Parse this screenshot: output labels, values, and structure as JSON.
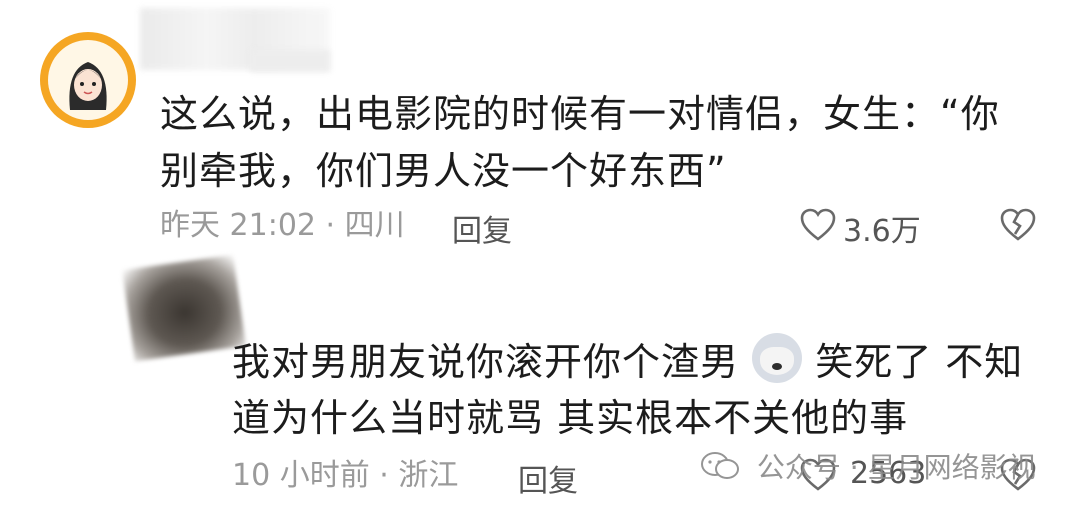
{
  "comment1": {
    "avatar_icon": "cartoon-girl-avatar-icon",
    "text_line1": "这么说，出电影院的时候有一对情侣，女生：“你",
    "text_line2": "别牵我，你们男人没一个好东西”",
    "meta": "昨天 21:02 · 四川",
    "reply_label": "回复",
    "like_icon": "heart-outline-icon",
    "like_count": "3.6万",
    "dislike_icon": "broken-heart-icon"
  },
  "comment2": {
    "text_line1_a": "我对男朋友说你滚开你个渣男",
    "emoji_icon": "husky-dog-emoji-icon",
    "text_line1_b": "笑死了 不知",
    "text_line2": "道为什么当时就骂 其实根本不关他的事",
    "meta": "10 小时前 · 浙江",
    "reply_label": "回复",
    "like_icon": "heart-outline-icon",
    "like_count": "2563",
    "dislike_icon": "broken-heart-icon"
  },
  "watermark": {
    "icon": "wechat-icon",
    "text": "公众号 · 星月网络影视"
  }
}
